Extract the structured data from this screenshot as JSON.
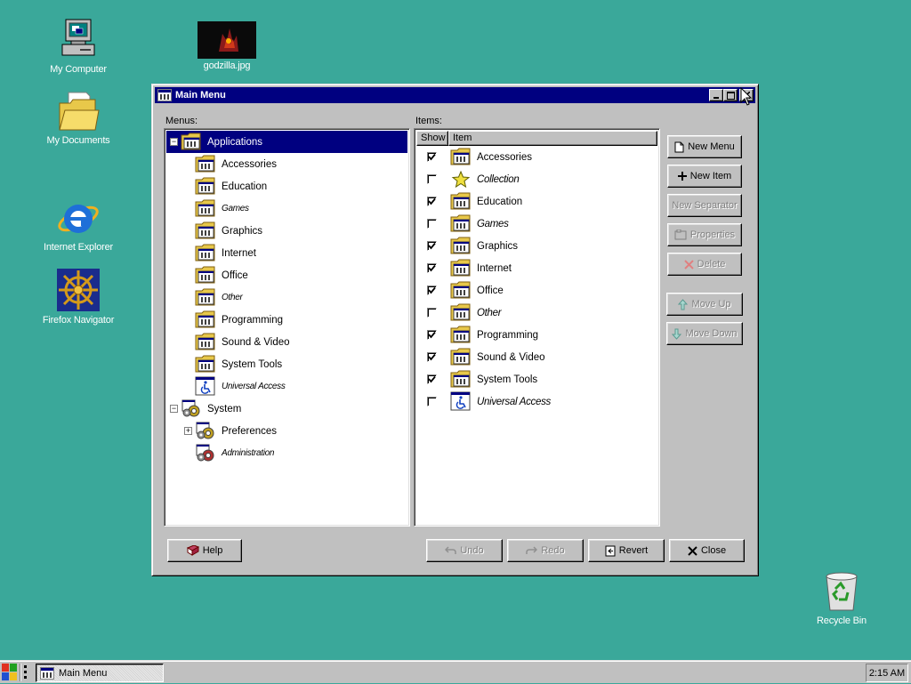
{
  "desktop": {
    "icons": [
      {
        "label": "My Computer",
        "icon": "computer-icon"
      },
      {
        "label": "godzilla.jpg",
        "icon": "image-file-icon"
      },
      {
        "label": "My Documents",
        "icon": "folder-documents-icon"
      },
      {
        "label": "Internet Explorer",
        "icon": "internet-explorer-icon"
      },
      {
        "label": "Firefox Navigator",
        "icon": "ship-wheel-icon"
      },
      {
        "label": "Recycle Bin",
        "icon": "recycle-bin-icon"
      }
    ],
    "background_color": "#3aa89a"
  },
  "window": {
    "title": "Main Menu",
    "menus_label": "Menus:",
    "items_label": "Items:",
    "tree": [
      {
        "label": "Applications",
        "level": 0,
        "expander": "−",
        "icon": "applications-folder-icon",
        "selected": true
      },
      {
        "label": "Accessories",
        "level": 1,
        "icon": "menu-folder-icon"
      },
      {
        "label": "Education",
        "level": 1,
        "icon": "menu-folder-icon"
      },
      {
        "label": "Games",
        "level": 1,
        "icon": "menu-folder-icon",
        "hidden": true
      },
      {
        "label": "Graphics",
        "level": 1,
        "icon": "menu-folder-icon"
      },
      {
        "label": "Internet",
        "level": 1,
        "icon": "menu-folder-icon"
      },
      {
        "label": "Office",
        "level": 1,
        "icon": "menu-folder-icon"
      },
      {
        "label": "Other",
        "level": 1,
        "icon": "menu-folder-icon",
        "hidden": true
      },
      {
        "label": "Programming",
        "level": 1,
        "icon": "menu-folder-icon"
      },
      {
        "label": "Sound & Video",
        "level": 1,
        "icon": "menu-folder-icon"
      },
      {
        "label": "System Tools",
        "level": 1,
        "icon": "menu-folder-icon"
      },
      {
        "label": "Universal Access",
        "level": 1,
        "icon": "accessibility-icon",
        "hidden": true
      },
      {
        "label": "System",
        "level": 0,
        "expander": "−",
        "icon": "system-gear-icon"
      },
      {
        "label": "Preferences",
        "level": 1,
        "expander": "+",
        "icon": "preferences-gear-icon"
      },
      {
        "label": "Administration",
        "level": 1,
        "icon": "administration-gear-icon",
        "hidden": true
      }
    ],
    "columns": {
      "show": "Show",
      "item": "Item"
    },
    "items": [
      {
        "label": "Accessories",
        "checked": true,
        "icon": "menu-folder-icon"
      },
      {
        "label": "Collection",
        "checked": false,
        "icon": "star-icon",
        "hidden": true
      },
      {
        "label": "Education",
        "checked": true,
        "icon": "menu-folder-icon"
      },
      {
        "label": "Games",
        "checked": false,
        "icon": "menu-folder-icon",
        "hidden": true
      },
      {
        "label": "Graphics",
        "checked": true,
        "icon": "menu-folder-icon"
      },
      {
        "label": "Internet",
        "checked": true,
        "icon": "menu-folder-icon"
      },
      {
        "label": "Office",
        "checked": true,
        "icon": "menu-folder-icon"
      },
      {
        "label": "Other",
        "checked": false,
        "icon": "menu-folder-icon",
        "hidden": true
      },
      {
        "label": "Programming",
        "checked": true,
        "icon": "menu-folder-icon"
      },
      {
        "label": "Sound & Video",
        "checked": true,
        "icon": "menu-folder-icon"
      },
      {
        "label": "System Tools",
        "checked": true,
        "icon": "menu-folder-icon"
      },
      {
        "label": "Universal Access",
        "checked": false,
        "icon": "accessibility-icon",
        "hidden": true
      }
    ],
    "side_buttons": {
      "new_menu": "New Menu",
      "new_item": "New Item",
      "new_separator": "New Separator",
      "properties": "Properties",
      "delete": "Delete",
      "move_up": "Move Up",
      "move_down": "Move Down"
    },
    "bottom_buttons": {
      "help": "Help",
      "undo": "Undo",
      "redo": "Redo",
      "revert": "Revert",
      "close": "Close"
    }
  },
  "taskbar": {
    "task_label": "Main Menu",
    "clock": "2:15 AM"
  }
}
